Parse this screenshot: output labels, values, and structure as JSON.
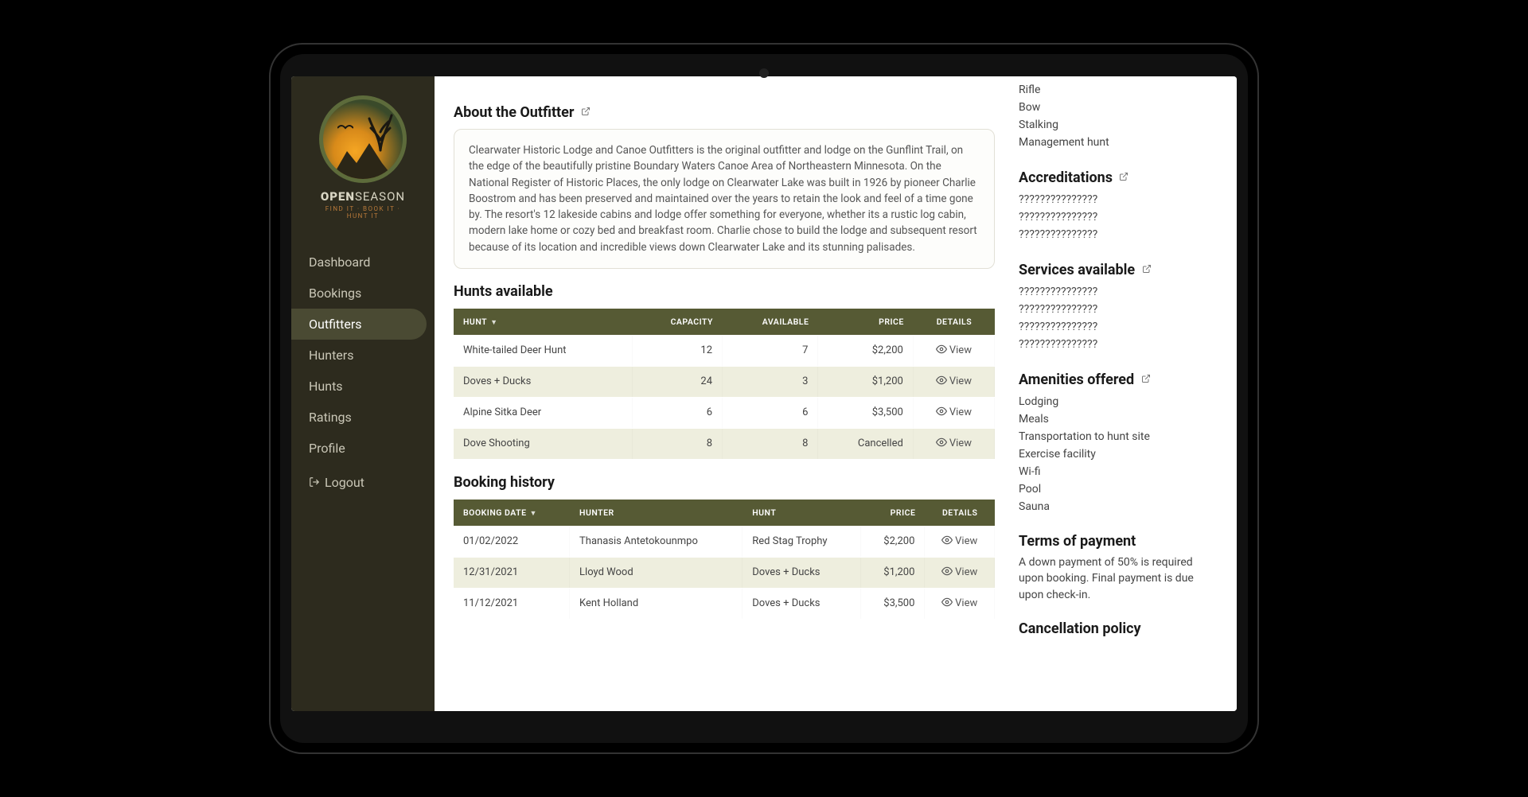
{
  "brand": {
    "main1": "OPEN",
    "main2": "SEASON",
    "sub": "FIND IT · BOOK IT · HUNT IT"
  },
  "nav": {
    "dashboard": "Dashboard",
    "bookings": "Bookings",
    "outfitters": "Outfitters",
    "hunters": "Hunters",
    "hunts": "Hunts",
    "ratings": "Ratings",
    "profile": "Profile",
    "logout": "Logout"
  },
  "about": {
    "heading": "About the Outfitter",
    "body": "Clearwater Historic Lodge and Canoe Outfitters is the original outfitter and lodge on the Gunflint Trail, on the edge of the beautifully pristine Boundary Waters Canoe Area of Northeastern Minnesota.  On the National Register of Historic Places, the only lodge on Clearwater Lake was built in 1926 by pioneer Charlie Boostrom and has been preserved and maintained over the years to retain the look and feel of a time gone by.  The resort's 12 lakeside cabins and lodge offer something for everyone, whether its a rustic log cabin, modern lake home or cozy bed and breakfast room.  Charlie chose to build the lodge and subsequent resort because of its location and incredible views down Clearwater Lake and its stunning palisades."
  },
  "hunts": {
    "heading": "Hunts available",
    "cols": {
      "hunt": "Hunt",
      "capacity": "Capacity",
      "available": "Available",
      "price": "Price",
      "details": "Details"
    },
    "view": "View",
    "rows": [
      {
        "hunt": "White-tailed Deer Hunt",
        "capacity": "12",
        "available": "7",
        "price": "$2,200"
      },
      {
        "hunt": "Doves + Ducks",
        "capacity": "24",
        "available": "3",
        "price": "$1,200"
      },
      {
        "hunt": "Alpine Sitka Deer",
        "capacity": "6",
        "available": "6",
        "price": "$3,500"
      },
      {
        "hunt": "Dove Shooting",
        "capacity": "8",
        "available": "8",
        "price": "Cancelled"
      }
    ]
  },
  "bookings": {
    "heading": "Booking history",
    "cols": {
      "date": "Booking date",
      "hunter": "Hunter",
      "hunt": "Hunt",
      "price": "Price",
      "details": "Details"
    },
    "view": "View",
    "rows": [
      {
        "date": "01/02/2022",
        "hunter": "Thanasis Antetokounmpo",
        "hunt": "Red Stag Trophy",
        "price": "$2,200"
      },
      {
        "date": "12/31/2021",
        "hunter": "Lloyd Wood",
        "hunt": "Doves + Ducks",
        "price": "$1,200"
      },
      {
        "date": "11/12/2021",
        "hunter": "Kent Holland",
        "hunt": "Doves + Ducks",
        "price": "$3,500"
      }
    ]
  },
  "right": {
    "leading_items": [
      "Rifle",
      "Bow",
      "Stalking",
      "Management hunt"
    ],
    "accreditations": {
      "heading": "Accreditations",
      "items": [
        "???????????????",
        "???????????????",
        "???????????????"
      ]
    },
    "services": {
      "heading": "Services available",
      "items": [
        "???????????????",
        "???????????????",
        "???????????????",
        "???????????????"
      ]
    },
    "amenities": {
      "heading": "Amenities offered",
      "items": [
        "Lodging",
        "Meals",
        "Transportation to hunt site",
        "Exercise facility",
        "Wi-fi",
        "Pool",
        "Sauna"
      ]
    },
    "terms": {
      "heading": "Terms of payment",
      "body": "A down payment of 50% is required upon booking. Final payment is due upon check-in."
    },
    "cancellation": {
      "heading": "Cancellation policy"
    }
  }
}
